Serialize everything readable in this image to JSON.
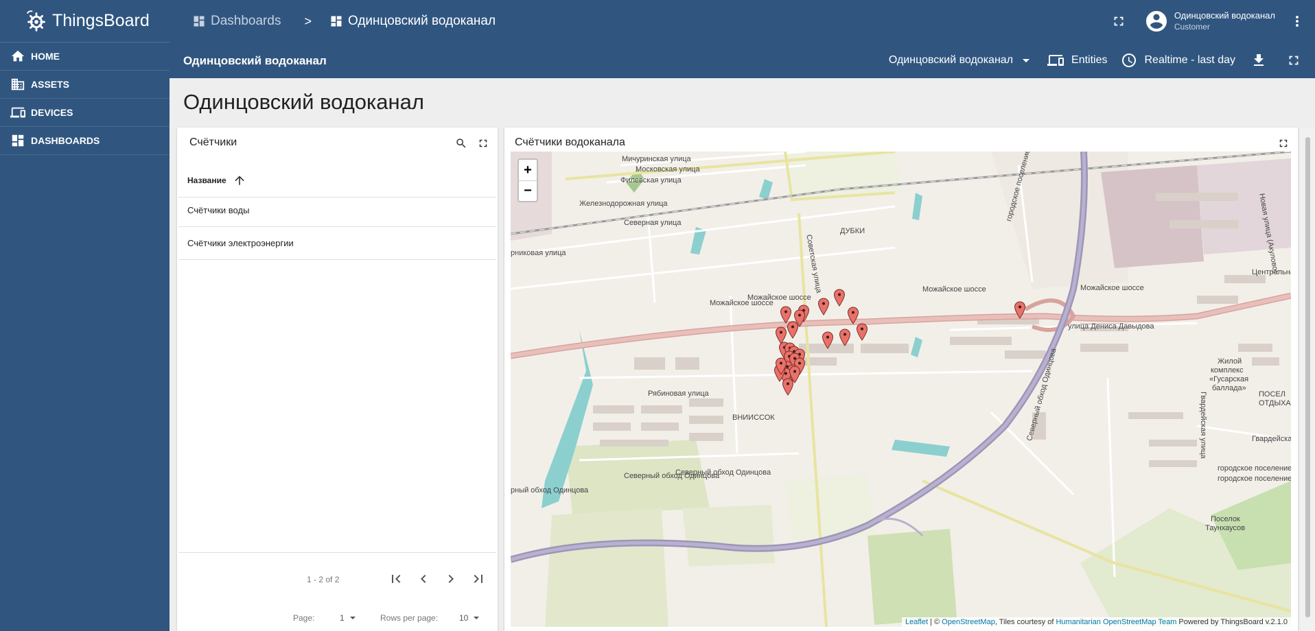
{
  "brand": {
    "name": "ThingsBoard"
  },
  "sidebar": {
    "items": [
      {
        "label": "HOME",
        "icon": "home-icon"
      },
      {
        "label": "ASSETS",
        "icon": "assets-icon"
      },
      {
        "label": "DEVICES",
        "icon": "devices-icon"
      },
      {
        "label": "DASHBOARDS",
        "icon": "dashboards-icon"
      }
    ]
  },
  "header": {
    "breadcrumb": {
      "root": "Dashboards",
      "separator": ">",
      "current": "Одинцовский водоканал"
    },
    "user": {
      "name": "Одинцовский водоканал",
      "role": "Customer"
    }
  },
  "dashboard_toolbar": {
    "title": "Одинцовский водоканал",
    "state_selected": "Одинцовский водоканал",
    "entities_label": "Entities",
    "timewindow_label": "Realtime - last day"
  },
  "page": {
    "title": "Одинцовский водоканал"
  },
  "table_widget": {
    "title": "Счётчики",
    "column_header": "Название",
    "rows": [
      "Счётчики воды",
      "Счётчики электроэнергии"
    ],
    "range_text": "1 - 2 of 2",
    "page_label": "Page:",
    "page_value": "1",
    "rows_label": "Rows per page:",
    "rows_value": "10"
  },
  "map_widget": {
    "title": "Счётчики водоканала",
    "zoom_in": "+",
    "zoom_out": "−",
    "attribution": {
      "leaflet": "Leaflet",
      "sep": " | © ",
      "osm": "OpenStreetMap",
      "tiles": ", Tiles courtesy of ",
      "hot": "Humanitarian OpenStreetMap Team",
      "powered": "Powered by ThingsBoard v.2.1.0"
    },
    "labels": [
      "Мичуринская улица",
      "Московская улица",
      "Филевская улица",
      "Железнодорожная улица",
      "Северная улица",
      "ДУБКИ",
      "Советская улица",
      "рниковая улица",
      "Можайское шоссе",
      "Можайское шоссе",
      "Можайское шоссе",
      "Можайское шоссе",
      "улица Дениса Давыдова",
      "Центральная у",
      "Новая улица (Акулово)",
      "городское поселение Одинцово",
      "Северный обход Одинцова",
      "Северный обход Одинцова",
      "Рябиновая улица",
      "ВНИИССОК",
      "Жилой",
      "комплекс",
      "«Гусарская",
      "баллада»",
      "Гвардейская улица",
      "Гвардейская улица",
      "ПОСЕЛ",
      "ОТДЫХА",
      "городское поселение Одинцово",
      "городское поселение Лесной Городок",
      "Северный обход Одинцова",
      "рный обход Одинцова",
      "Поселок",
      "Таунхаусов"
    ],
    "marker_count": 26
  },
  "colors": {
    "primary": "#305680",
    "marker": "#e8726a",
    "road_major": "#d99e97",
    "highway": "#9e95b8"
  }
}
